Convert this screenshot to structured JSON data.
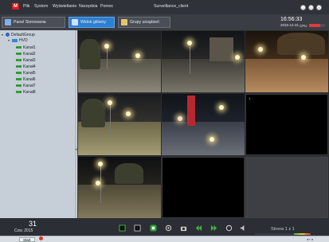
{
  "app": {
    "logo_text": "M",
    "title": "Surveillance_client"
  },
  "menu": [
    "Plik",
    "System",
    "Wyświetlanie",
    "Narzędzia",
    "Pomoc"
  ],
  "window_buttons": [
    "minimize",
    "maximize",
    "close"
  ],
  "tabs": [
    {
      "label": "Panel Sterowania",
      "icon": "control-panel-icon"
    },
    {
      "label": "Widok główny",
      "icon": "main-view-icon",
      "active": true
    },
    {
      "label": "Grupy urządzeń",
      "icon": "device-groups-icon"
    }
  ],
  "clock": {
    "time": "16:56:33",
    "date": "2015-12-31",
    "cpu_label": "CPU",
    "cpu_fraction": 0.7
  },
  "tree": {
    "group": "DefaultGroup",
    "device": "HVD",
    "channels": [
      "Kanał1",
      "Kanał2",
      "Kanał3",
      "Kanał4",
      "Kanał5",
      "Kanał6",
      "Kanał7",
      "Kanał8"
    ]
  },
  "grid": {
    "selected_tile_label": "1"
  },
  "status": {
    "day_number": "31",
    "day_text": "Czw. 2015",
    "page_indicator": "Strona 1 z 1"
  },
  "controls": [
    "layout-1x1-icon",
    "layout-grid-icon",
    "record-icon",
    "ptz-icon",
    "snapshot-icon",
    "previous-icon",
    "next-icon",
    "refresh-icon",
    "audio-icon"
  ],
  "taskbar": {
    "start_label": "Start"
  },
  "colors": {
    "accent": "#2f7fd0",
    "record": "#2aa030",
    "logo": "#d01f1f"
  }
}
